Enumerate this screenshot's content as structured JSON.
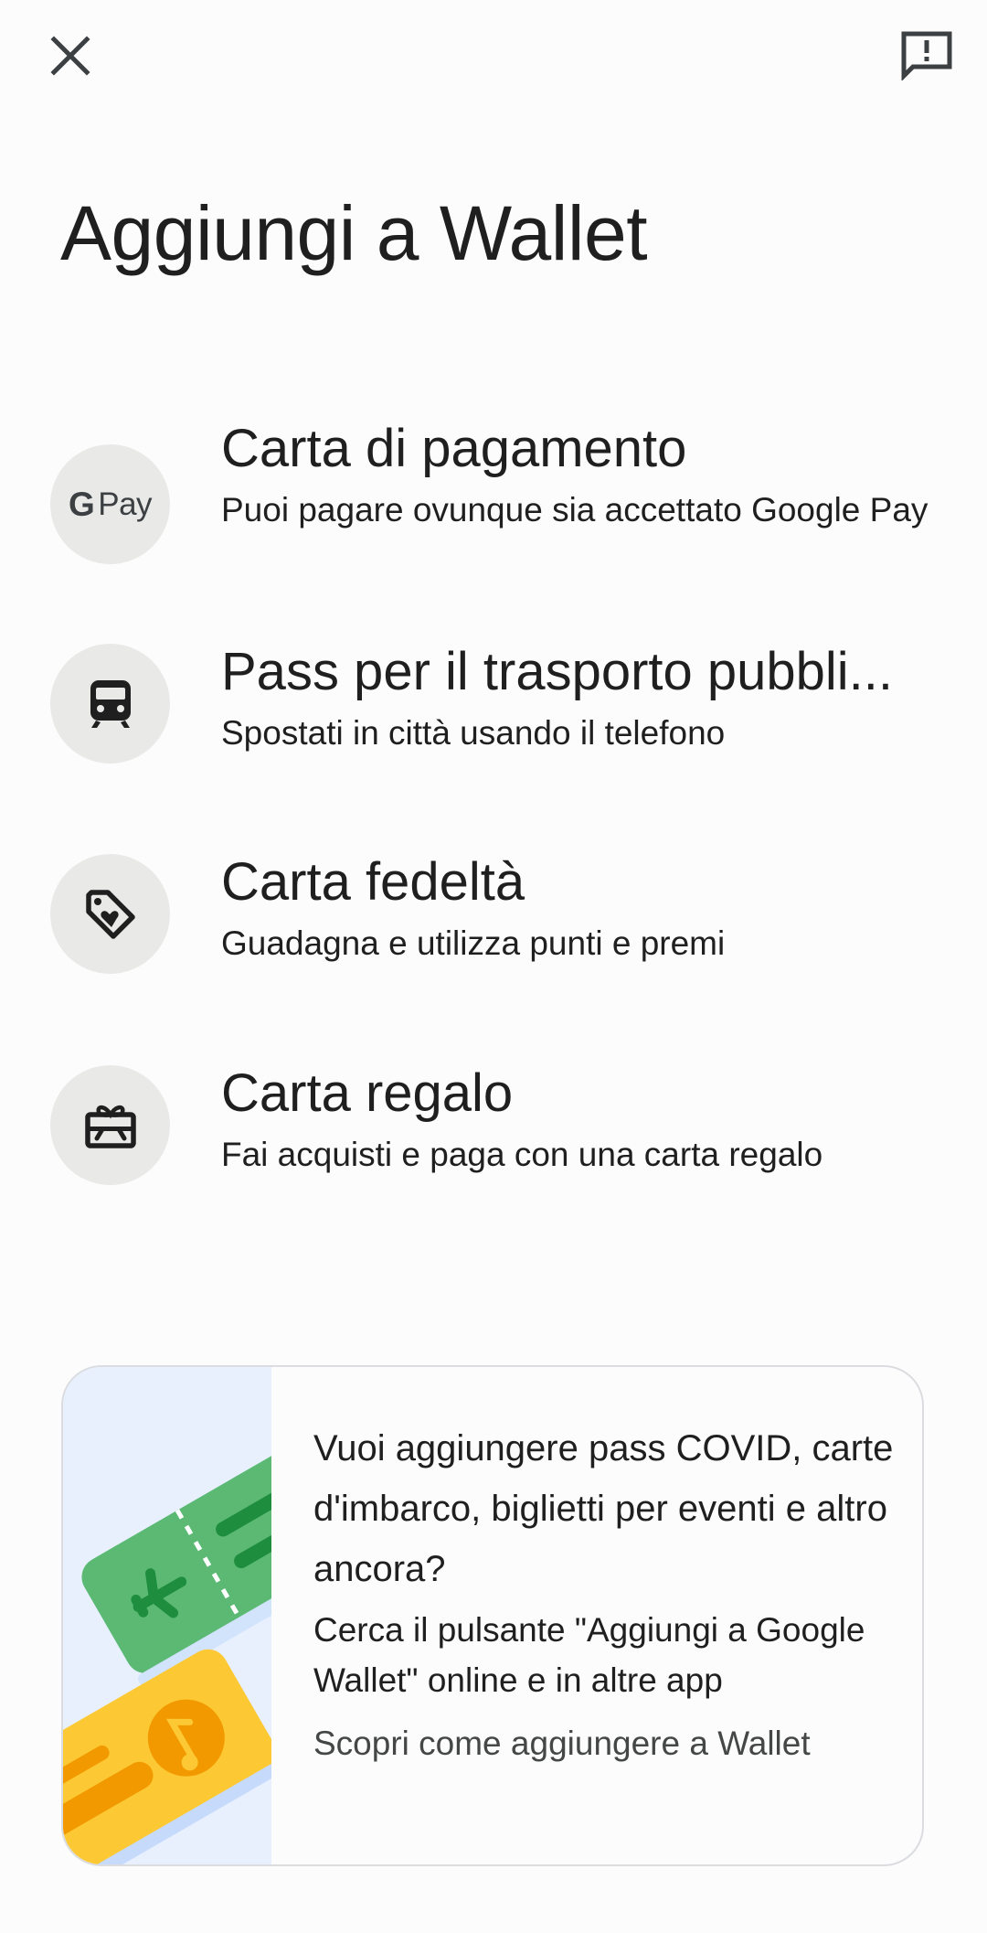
{
  "header": {
    "close_icon": "close-icon",
    "feedback_icon": "feedback-icon"
  },
  "page": {
    "title": "Aggiungi a Wallet"
  },
  "options": [
    {
      "icon": "gpay-icon",
      "icon_text_g": "G",
      "icon_text_pay": "Pay",
      "title": "Carta di pagamento",
      "description": "Puoi pagare ovunque sia accettato Google Pay"
    },
    {
      "icon": "train-icon",
      "title": "Pass per il trasporto pubbli...",
      "description": "Spostati in città usando il telefono"
    },
    {
      "icon": "tag-heart-icon",
      "title": "Carta fedeltà",
      "description": "Guadagna e utilizza punti e premi"
    },
    {
      "icon": "gift-card-icon",
      "title": "Carta regalo",
      "description": "Fai acquisti e paga con una carta regalo"
    }
  ],
  "promo": {
    "heading": "Vuoi aggiungere pass COVID, carte d'imbarco, biglietti per eventi e altro ancora?",
    "body": "Cerca il pulsante \"Aggiungi a Google Wallet\" online e in altre app",
    "link": "Scopri come aggiungere a Wallet",
    "illustration": "boarding-pass-and-ticket-illustration"
  },
  "colors": {
    "background": "#fcfcfc",
    "icon_circle": "#e9eae8",
    "boarding_pass_green": "#5bb974",
    "ticket_yellow": "#fcc934",
    "ticket_orange": "#f29900",
    "illustration_bg": "#e8f0fe"
  }
}
